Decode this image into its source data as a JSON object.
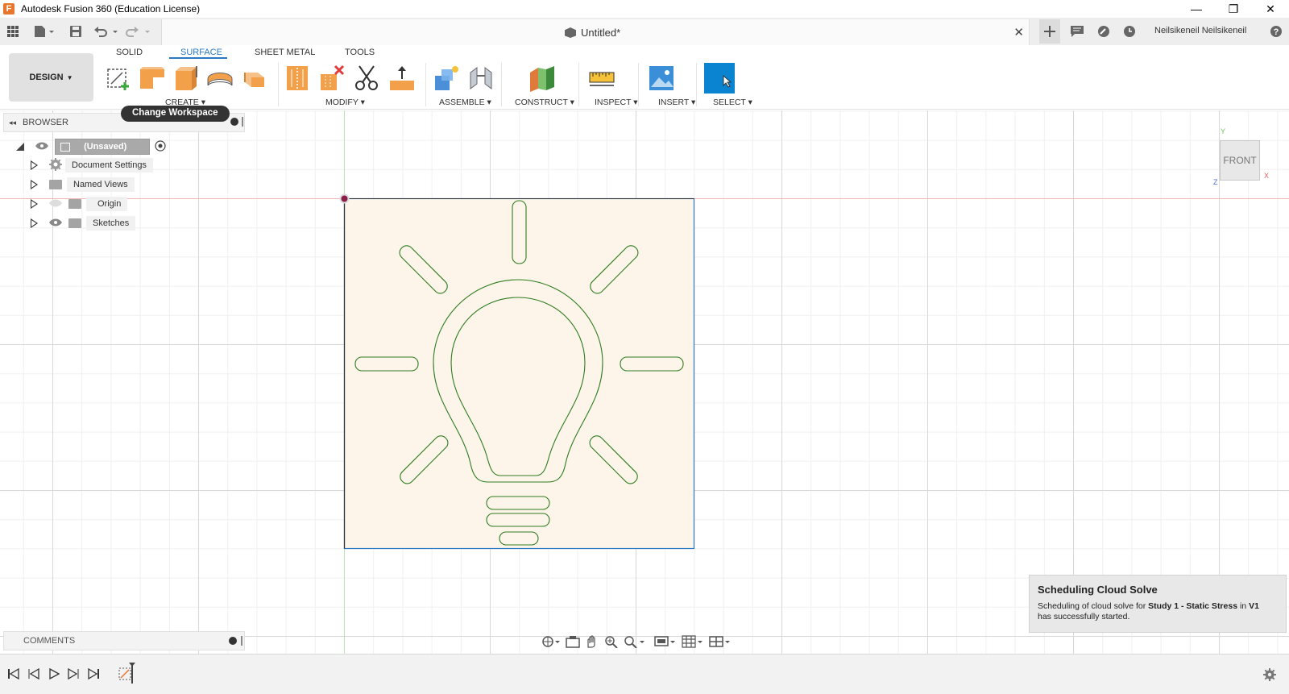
{
  "window": {
    "title": "Autodesk Fusion 360 (Education License)",
    "logo_letter": "F",
    "minimize_icon": "—",
    "maximize_icon": "❐",
    "close_icon": "✕"
  },
  "doc_tab": {
    "title": "Untitled*",
    "close_icon": "✕"
  },
  "user": {
    "name": "Neilsikeneil Neilsikeneil"
  },
  "toolbar": {
    "workspace_label": "DESIGN",
    "tabs": [
      "SOLID",
      "SURFACE",
      "SHEET METAL",
      "TOOLS"
    ],
    "active_tab": "SURFACE",
    "groups": [
      "CREATE",
      "MODIFY",
      "ASSEMBLE",
      "CONSTRUCT",
      "INSPECT",
      "INSERT",
      "SELECT"
    ],
    "tooltip": "Change Workspace"
  },
  "browser": {
    "header": "BROWSER",
    "root": "(Unsaved)",
    "items": [
      "Document Settings",
      "Named Views",
      "Origin",
      "Sketches"
    ]
  },
  "comments": {
    "label": "COMMENTS"
  },
  "viewcube": {
    "face": "FRONT",
    "axis_y": "Y",
    "axis_x": "X",
    "axis_z": "Z"
  },
  "notification": {
    "title": "Scheduling Cloud Solve",
    "prefix": "Scheduling of cloud solve for ",
    "study": "Study 1 - Static Stress",
    "middle": " in ",
    "version": "V1",
    "suffix": "has successfully started."
  },
  "colors": {
    "accent": "#2a79c4",
    "sketch_fill": "#fdf4ea",
    "sketch_line": "#2e7d1e",
    "select_blue": "#0a84d0"
  }
}
